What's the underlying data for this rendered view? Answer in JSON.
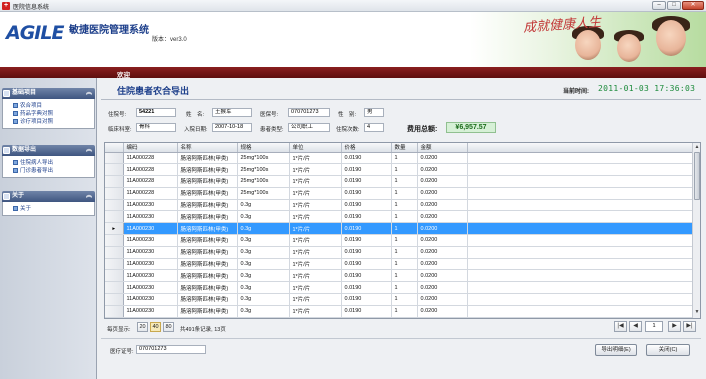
{
  "window": {
    "title": "医院信息系统",
    "controls": [
      "–",
      "□",
      "✕"
    ]
  },
  "banner": {
    "logo": "AGILE",
    "system_name": "敏捷医院管理系统",
    "version": "版本：ver3.0",
    "slogan": "成就健康人生"
  },
  "welcome": "欢迎",
  "sidebar": {
    "groups": [
      {
        "title": "基础项目",
        "items": [
          "农合项目",
          "药品字典对照",
          "诊疗项目对照"
        ]
      },
      {
        "title": "数据导出",
        "items": [
          "住院病人导出",
          "门诊患者导出"
        ]
      },
      {
        "title": "关于",
        "items": [
          "关于"
        ]
      }
    ]
  },
  "main": {
    "title": "住院患者农合导出",
    "time_label": "当前时间:",
    "time_value": "2011-01-03 17:36:03",
    "form": {
      "inpatient_no_label": "住院号:",
      "inpatient_no": "54221",
      "name_label": "姓　名:",
      "name": "王猴军",
      "insurance_no_label": "医保号:",
      "insurance_no": "070701273",
      "gender_label": "性　别:",
      "gender": "男",
      "dept_label": "临床科室:",
      "dept": "骨科",
      "admit_date_label": "入院日期:",
      "admit_date": "2007-10-18",
      "patient_type_label": "患者类型:",
      "patient_type": "公司职工",
      "admit_count_label": "住院次数:",
      "admit_count": "4",
      "fee_label": "费用总额:",
      "fee_total": "¥6,957.57"
    },
    "table": {
      "columns": [
        "编码",
        "名称",
        "规格",
        "单位",
        "价格",
        "数量",
        "金额"
      ],
      "rows": [
        [
          "11A000228",
          "肠溶阿斯匹林(甲类)",
          "25mg*100s",
          "1*片/片",
          "0.0190",
          "1",
          "0.0200"
        ],
        [
          "11A000228",
          "肠溶阿斯匹林(甲类)",
          "25mg*100s",
          "1*片/片",
          "0.0190",
          "1",
          "0.0200"
        ],
        [
          "11A000228",
          "肠溶阿斯匹林(甲类)",
          "25mg*100s",
          "1*片/片",
          "0.0190",
          "1",
          "0.0200"
        ],
        [
          "11A000228",
          "肠溶阿斯匹林(甲类)",
          "25mg*100s",
          "1*片/片",
          "0.0190",
          "1",
          "0.0200"
        ],
        [
          "11A000230",
          "肠溶阿斯匹林(甲类)",
          "0.3g",
          "1*片/片",
          "0.0190",
          "1",
          "0.0200"
        ],
        [
          "11A000230",
          "肠溶阿斯匹林(甲类)",
          "0.3g",
          "1*片/片",
          "0.0190",
          "1",
          "0.0200"
        ],
        [
          "11A000230",
          "肠溶阿斯匹林(甲类)",
          "0.3g",
          "1*片/片",
          "0.0190",
          "1",
          "0.0200"
        ],
        [
          "11A000230",
          "肠溶阿斯匹林(甲类)",
          "0.3g",
          "1*片/片",
          "0.0190",
          "1",
          "0.0200"
        ],
        [
          "11A000230",
          "肠溶阿斯匹林(甲类)",
          "0.3g",
          "1*片/片",
          "0.0190",
          "1",
          "0.0200"
        ],
        [
          "11A000230",
          "肠溶阿斯匹林(甲类)",
          "0.3g",
          "1*片/片",
          "0.0190",
          "1",
          "0.0200"
        ],
        [
          "11A000230",
          "肠溶阿斯匹林(甲类)",
          "0.3g",
          "1*片/片",
          "0.0190",
          "1",
          "0.0200"
        ],
        [
          "11A000230",
          "肠溶阿斯匹林(甲类)",
          "0.3g",
          "1*片/片",
          "0.0190",
          "1",
          "0.0200"
        ],
        [
          "11A000230",
          "肠溶阿斯匹林(甲类)",
          "0.3g",
          "1*片/片",
          "0.0190",
          "1",
          "0.0200"
        ],
        [
          "11A000230",
          "肠溶阿斯匹林(甲类)",
          "0.3g",
          "1*片/片",
          "0.0190",
          "1",
          "0.0200"
        ]
      ],
      "selected_row_index": 6,
      "row_marker": "▸"
    },
    "pager": {
      "label": "每页显示:",
      "sizes": [
        "20",
        "40",
        "80"
      ],
      "active_size": "40",
      "info": "共491条记录, 13页",
      "current_page": "1",
      "first": "|◀",
      "prev": "◀",
      "next": "▶",
      "last": "▶|"
    },
    "card_label": "医疗证号:",
    "card_value": "070701273",
    "export_button": "导出明细(E)",
    "close_button": "关闭(C)"
  }
}
